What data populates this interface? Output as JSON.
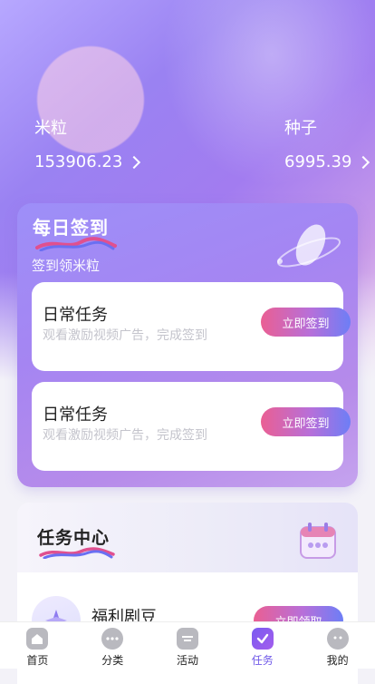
{
  "header": {
    "left": {
      "label": "米粒",
      "value": "153906.23"
    },
    "right": {
      "label": "种子",
      "value": "6995.39"
    }
  },
  "daily": {
    "title": "每日签到",
    "subtitle": "签到领米粒",
    "tasks": [
      {
        "title": "日常任务",
        "desc": "观看激励视频广告，完成签到",
        "button": "立即签到"
      },
      {
        "title": "日常任务",
        "desc": "观看激励视频广告，完成签到",
        "button": "立即签到"
      }
    ]
  },
  "center": {
    "title": "任务中心",
    "items": [
      {
        "title": "福利剧豆",
        "button": "立即领取"
      }
    ]
  },
  "tabs": [
    {
      "label": "首页",
      "icon": "home-icon"
    },
    {
      "label": "分类",
      "icon": "category-icon"
    },
    {
      "label": "活动",
      "icon": "activity-icon"
    },
    {
      "label": "任务",
      "icon": "task-icon",
      "active": true
    },
    {
      "label": "我的",
      "icon": "profile-icon"
    }
  ],
  "colors": {
    "accent": "#6f58e8",
    "button_start": "#ea5f93",
    "button_end": "#6d7ef6"
  }
}
